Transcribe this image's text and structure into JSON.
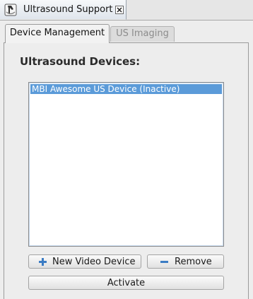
{
  "view_tab": {
    "title": "Ultrasound Support",
    "icon": "ultrasound-probe-icon",
    "close_icon": "close-icon"
  },
  "tabs": [
    {
      "label": "Device Management",
      "active": true
    },
    {
      "label": "US Imaging",
      "active": false
    }
  ],
  "device_management": {
    "section_title": "Ultrasound Devices:",
    "devices": [
      {
        "label": "MBI Awesome US Device (Inactive)",
        "selected": true
      }
    ],
    "buttons": {
      "new_device": {
        "label": "New Video Device",
        "icon": "plus-icon"
      },
      "remove": {
        "label": "Remove",
        "icon": "minus-icon"
      },
      "activate": {
        "label": "Activate"
      }
    }
  },
  "colors": {
    "selection": "#5b9bd9",
    "icon_blue": "#3b7cc4",
    "window_bg": "#ededed"
  }
}
